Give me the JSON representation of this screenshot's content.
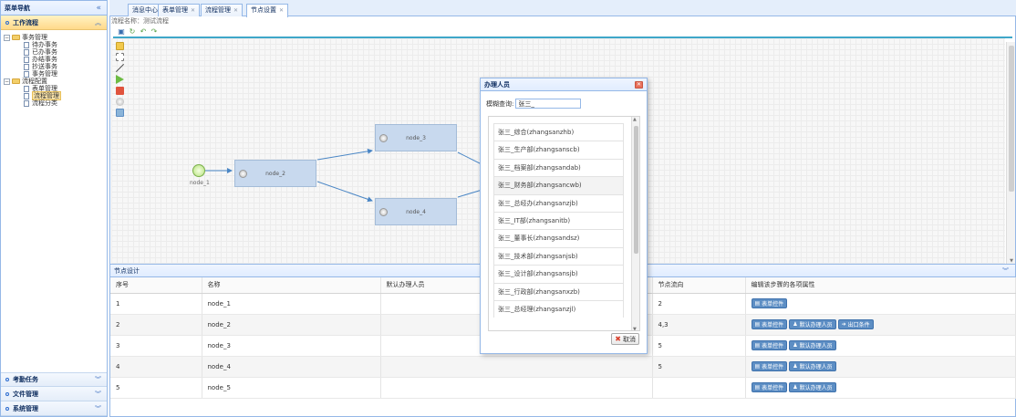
{
  "sidebar": {
    "title": "菜单导航",
    "collapse_icon": "«",
    "sections": [
      {
        "label": "工作流程",
        "active": true
      },
      {
        "label": "考勤任务"
      },
      {
        "label": "文件管理"
      },
      {
        "label": "系统管理"
      }
    ],
    "tree": [
      {
        "label": "事务管理",
        "type": "folder",
        "level": 1
      },
      {
        "label": "待办事务",
        "type": "file",
        "level": 2
      },
      {
        "label": "已办事务",
        "type": "file",
        "level": 2
      },
      {
        "label": "办结事务",
        "type": "file",
        "level": 2
      },
      {
        "label": "抄送事务",
        "type": "file",
        "level": 2
      },
      {
        "label": "事务管理",
        "type": "file",
        "level": 2
      },
      {
        "label": "流程配置",
        "type": "folder",
        "level": 1
      },
      {
        "label": "表单管理",
        "type": "file",
        "level": 2
      },
      {
        "label": "流程管理",
        "type": "file",
        "level": 2,
        "selected": true
      },
      {
        "label": "流程分类",
        "type": "file",
        "level": 2
      }
    ]
  },
  "tabs": [
    {
      "label": "消息中心",
      "closable": false
    },
    {
      "label": "表单管理",
      "closable": true
    },
    {
      "label": "流程管理",
      "closable": true
    },
    {
      "label": "节点设置",
      "closable": true,
      "active": true
    }
  ],
  "flow_name_label": "流程名称：测试流程",
  "nodes": {
    "start": "node_1",
    "n2": "node_2",
    "n3": "node_3",
    "n4": "node_4"
  },
  "design": {
    "title": "节点设计",
    "columns": [
      "序号",
      "名称",
      "默认办理人员",
      "节点流向",
      "编辑该步骤的各项属性"
    ],
    "rows": [
      {
        "no": "1",
        "name": "node_1",
        "flow": "2",
        "buttons": [
          "form"
        ]
      },
      {
        "no": "2",
        "name": "node_2",
        "flow": "4,3",
        "buttons": [
          "form",
          "person",
          "exit"
        ]
      },
      {
        "no": "3",
        "name": "node_3",
        "flow": "5",
        "buttons": [
          "form",
          "person"
        ]
      },
      {
        "no": "4",
        "name": "node_4",
        "flow": "5",
        "buttons": [
          "form",
          "person"
        ]
      },
      {
        "no": "5",
        "name": "node_5",
        "flow": "",
        "buttons": [
          "form",
          "person"
        ]
      }
    ],
    "button_labels": {
      "form": "表单控件",
      "person": "默认办理人员",
      "exit": "出口条件"
    }
  },
  "dialog": {
    "title": "办理人员",
    "search_label": "模糊查询:",
    "search_value": "张三_",
    "items": [
      "张三_综合(zhangsanzhb)",
      "张三_生产部(zhangsanscb)",
      "张三_档案部(zhangsandab)",
      "张三_财务部(zhangsancwb)",
      "张三_总经办(zhangsanzjb)",
      "张三_IT部(zhangsanitb)",
      "张三_董事长(zhangsandsz)",
      "张三_技术部(zhangsanjsb)",
      "张三_设计部(zhangsansjb)",
      "张三_行政部(zhangsanxzb)",
      "张三_总经理(zhangsanzjl)"
    ],
    "highlighted_index": 3,
    "cancel_label": "取消"
  },
  "colors": {
    "accent_border": "#95b8e7",
    "node_fill": "#c8d9ee",
    "button_blue": "#5d8ec4",
    "active_accordion": "#ffd98a"
  }
}
